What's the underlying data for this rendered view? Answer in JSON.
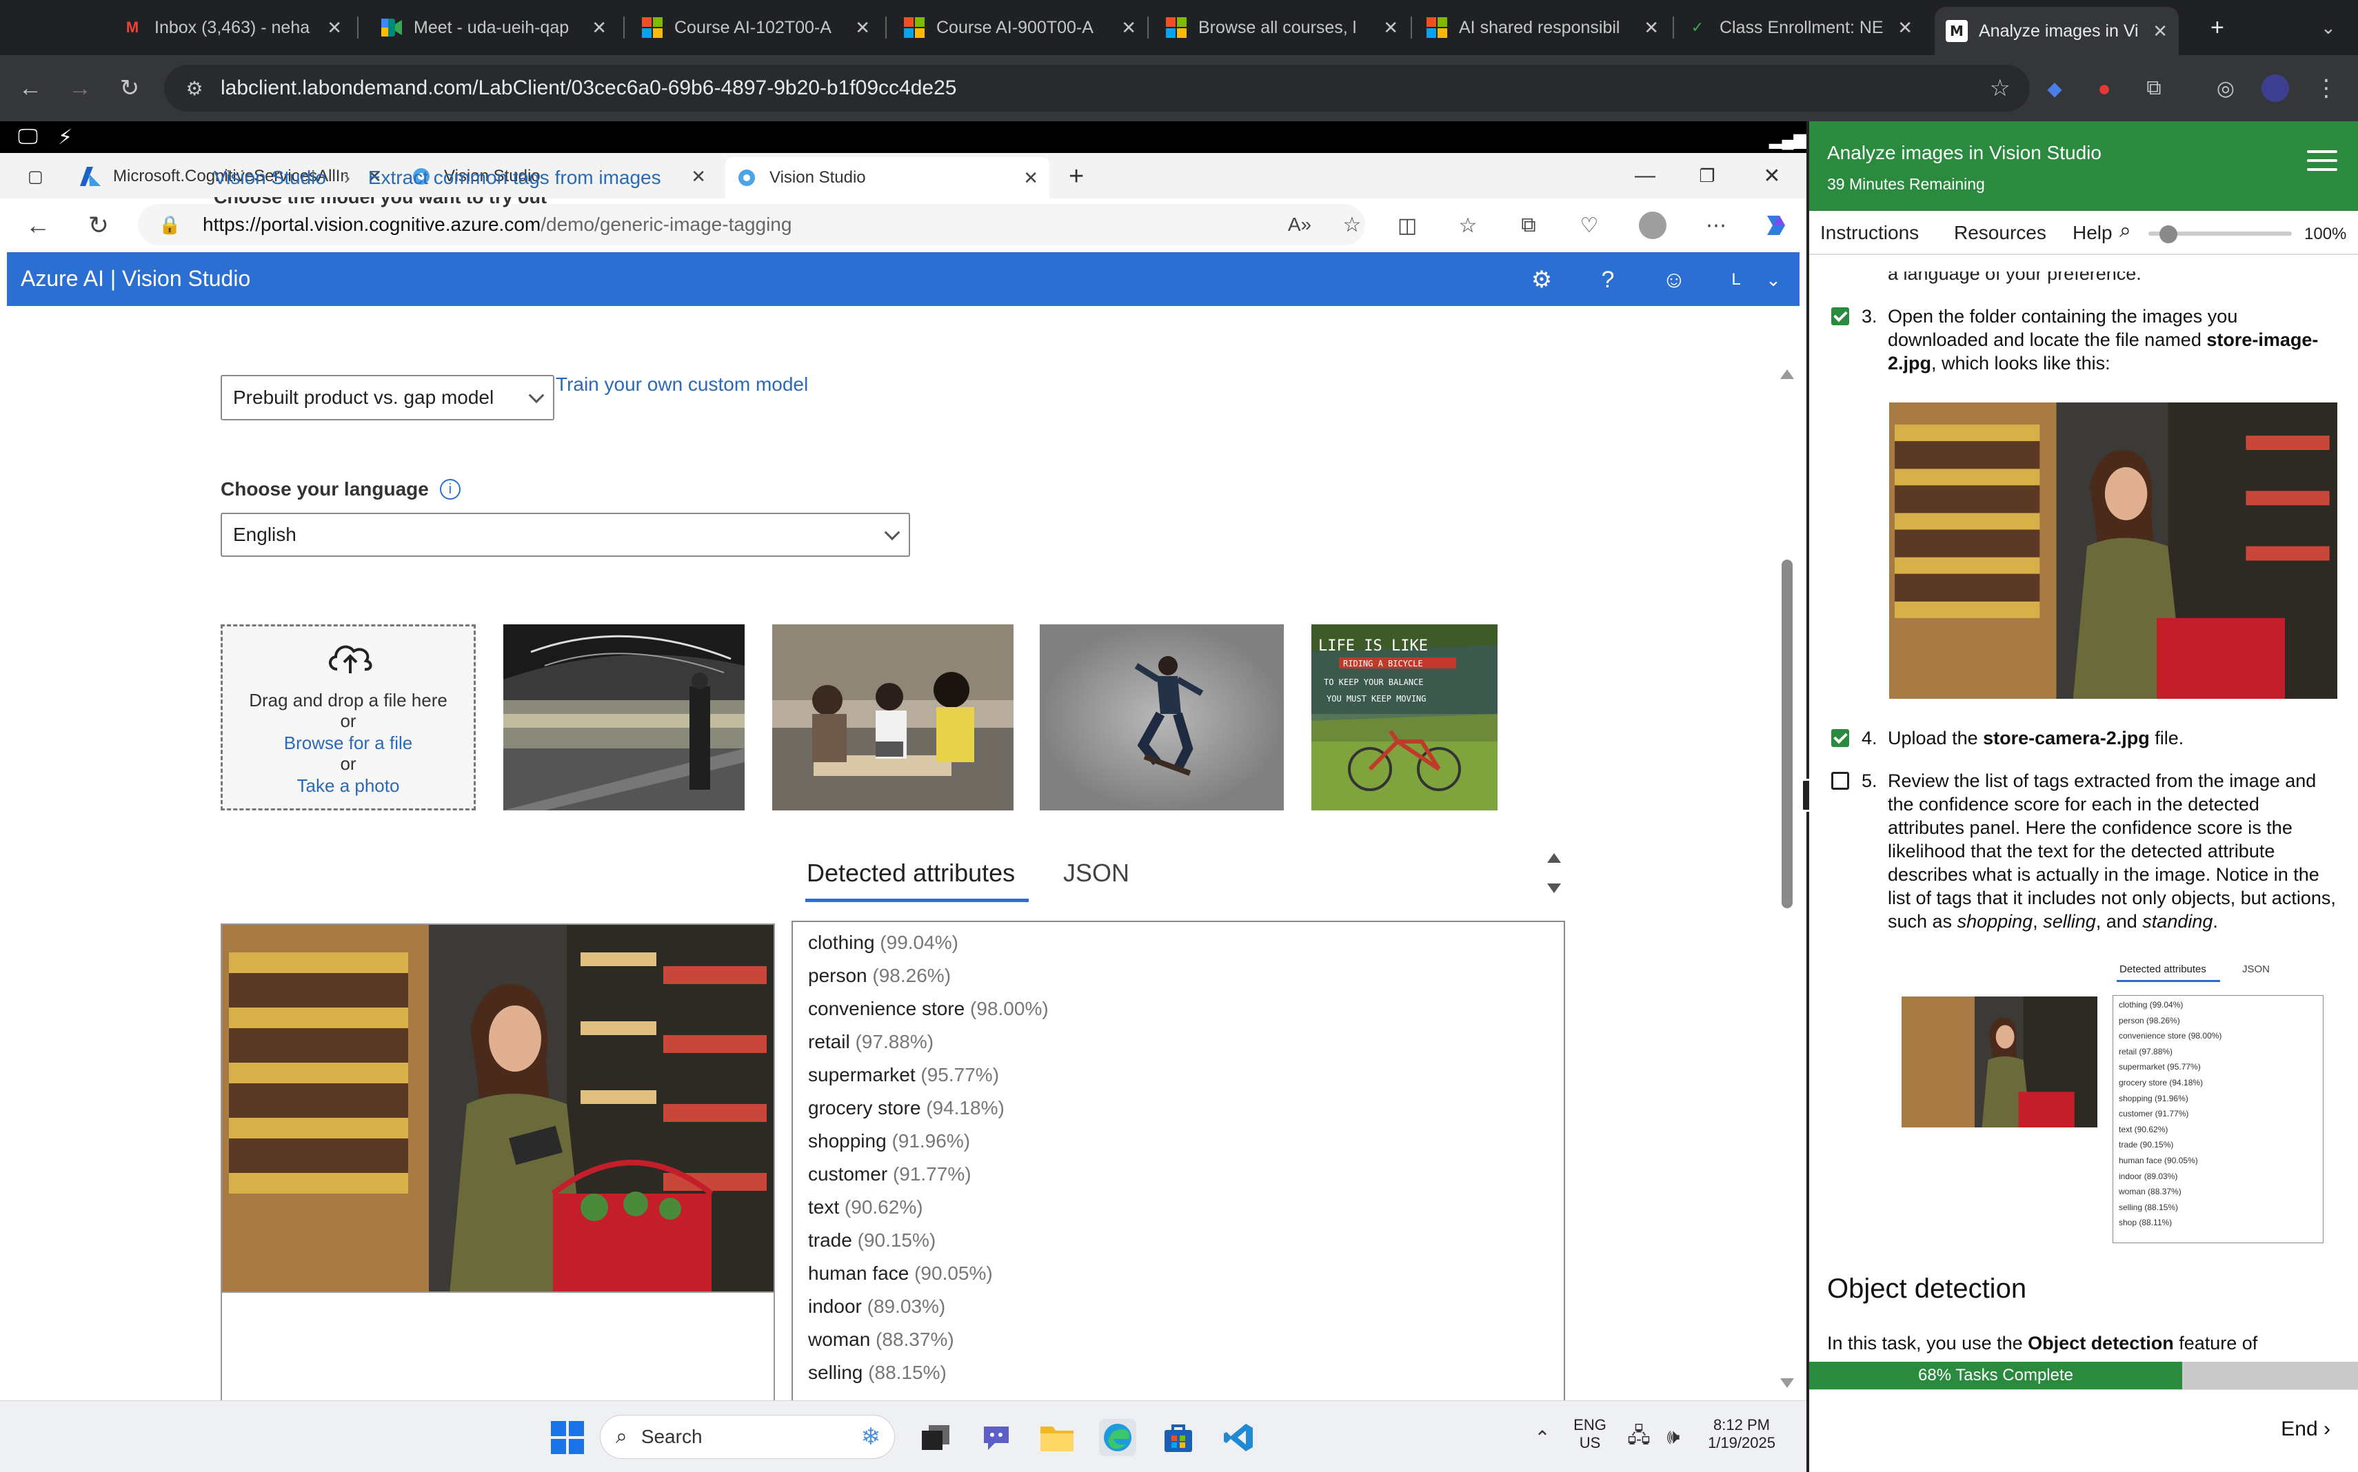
{
  "chrome": {
    "tabs": [
      {
        "title": "Inbox (3,463) - neha",
        "icon": "gmail-icon"
      },
      {
        "title": "Meet - uda-ueih-qap",
        "icon": "meet-icon"
      },
      {
        "title": "Course AI-102T00-A",
        "icon": "microsoft-icon"
      },
      {
        "title": "Course AI-900T00-A",
        "icon": "microsoft-icon"
      },
      {
        "title": "Browse all courses, l",
        "icon": "microsoft-icon"
      },
      {
        "title": "AI shared responsibil",
        "icon": "microsoft-icon"
      },
      {
        "title": "Class Enrollment: NE",
        "icon": "check-icon"
      },
      {
        "title": "Analyze images in Vi",
        "icon": "lab-icon"
      }
    ],
    "url": "labclient.labondemand.com/LabClient/03cec6a0-69b6-4897-9b20-b1f09cc4de25"
  },
  "edge": {
    "tabs": [
      {
        "title": "Microsoft.CognitiveServicesAllInO"
      },
      {
        "title": "Vision Studio"
      },
      {
        "title": "Vision Studio"
      }
    ],
    "url_host": "https://portal.vision.cognitive.azure.com",
    "url_path": "/demo/generic-image-tagging"
  },
  "vision_studio": {
    "brand": "Azure AI  |  Vision Studio",
    "user_initial": "L",
    "breadcrumb": [
      "Vision Studio",
      "Extract common tags from images"
    ],
    "cut_label": "Choose the model you want to try out",
    "model_select": "Prebuilt product vs. gap model",
    "train_link": "Train your own custom model",
    "language_label": "Choose your language",
    "language_value": "English",
    "dropzone": {
      "line1": "Drag and drop a file here",
      "or1": "or",
      "browse": "Browse for a file",
      "or2": "or",
      "photo": "Take a photo"
    },
    "sample_poster_lines": [
      "LIFE IS LIKE",
      "RIDING A BICYCLE",
      "TO KEEP YOUR BALANCE",
      "YOU MUST KEEP MOVING"
    ],
    "result_tabs": [
      "Detected attributes",
      "JSON"
    ],
    "attributes": [
      {
        "name": "clothing",
        "pct": "(99.04%)"
      },
      {
        "name": "person",
        "pct": "(98.26%)"
      },
      {
        "name": "convenience store",
        "pct": "(98.00%)"
      },
      {
        "name": "retail",
        "pct": "(97.88%)"
      },
      {
        "name": "supermarket",
        "pct": "(95.77%)"
      },
      {
        "name": "grocery store",
        "pct": "(94.18%)"
      },
      {
        "name": "shopping",
        "pct": "(91.96%)"
      },
      {
        "name": "customer",
        "pct": "(91.77%)"
      },
      {
        "name": "text",
        "pct": "(90.62%)"
      },
      {
        "name": "trade",
        "pct": "(90.15%)"
      },
      {
        "name": "human face",
        "pct": "(90.05%)"
      },
      {
        "name": "indoor",
        "pct": "(89.03%)"
      },
      {
        "name": "woman",
        "pct": "(88.37%)"
      },
      {
        "name": "selling",
        "pct": "(88.15%)"
      }
    ]
  },
  "taskbar": {
    "search": "Search",
    "lang1": "ENG",
    "lang2": "US",
    "time": "8:12 PM",
    "date": "1/19/2025"
  },
  "lab": {
    "title": "Analyze images in Vision Studio",
    "remaining": "39 Minutes Remaining",
    "tabs": [
      "Instructions",
      "Resources",
      "Help"
    ],
    "zoom": "100%",
    "cut_text": "a language of your preference.",
    "step3": {
      "num": "3.",
      "pre": "Open the folder containing the images you downloaded and locate the file named ",
      "bold": "store-image-2.jpg",
      "post": ", which looks like this:",
      "done": true
    },
    "step4": {
      "num": "4.",
      "pre": "Upload the ",
      "bold": "store-camera-2.jpg",
      "post": " file.",
      "done": true
    },
    "step5": {
      "num": "5.",
      "text": "Review the list of tags extracted from the image and the confidence score for each in the detected attributes panel. Here the confidence score is the likelihood that the text for the detected attribute describes what is actually in the image. Notice in the list of tags that it includes not only objects, but actions, such as ",
      "i1": "shopping",
      "sep1": ", ",
      "i2": "selling",
      "sep2": ", and ",
      "i3": "standing",
      "end": ".",
      "done": false
    },
    "mini_tabs": [
      "Detected attributes",
      "JSON"
    ],
    "mini_list": [
      "clothing (99.04%)",
      "person (98.26%)",
      "convenience store (98.00%)",
      "retail (97.88%)",
      "supermarket (95.77%)",
      "grocery store (94.18%)",
      "shopping (91.96%)",
      "customer (91.77%)",
      "text (90.62%)",
      "trade (90.15%)",
      "human face (90.05%)",
      "indoor (89.03%)",
      "woman (88.37%)",
      "selling (88.15%)",
      "shop (88.11%)"
    ],
    "heading": "Object detection",
    "para_pre": "In this task, you use the ",
    "para_bold": "Object detection",
    "para_post": " feature of",
    "progress_text": "68% Tasks Complete",
    "progress": 0.68,
    "end": "End"
  },
  "colors": {
    "azure_header": "#2c6fd3",
    "lab_green": "#2a8a3e",
    "link": "#2a6ab8"
  }
}
